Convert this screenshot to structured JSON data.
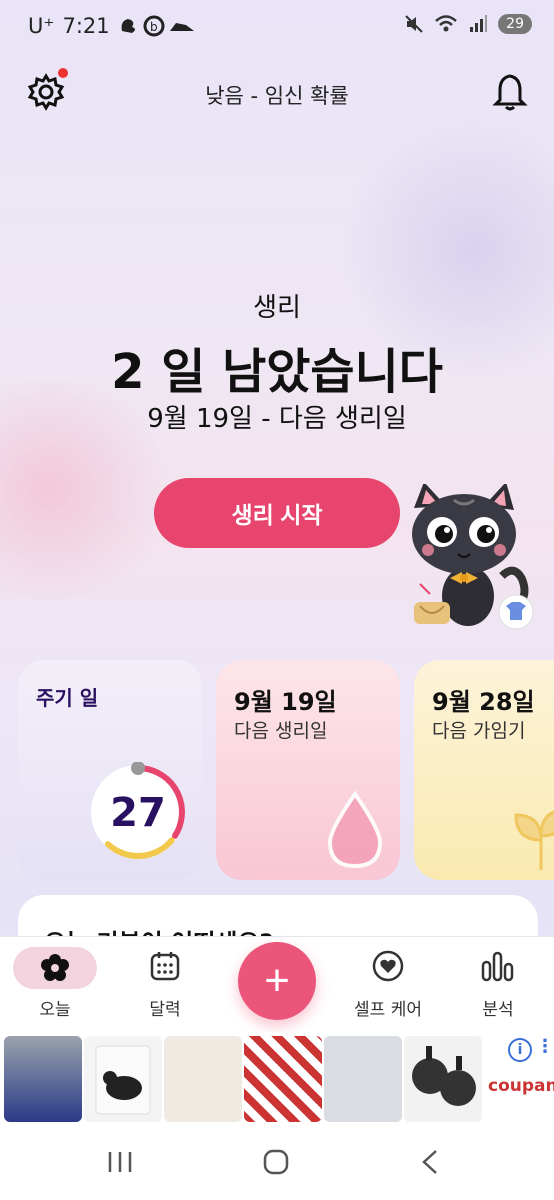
{
  "status_bar": {
    "carrier": "U⁺",
    "time": "7:21",
    "battery": "29"
  },
  "header": {
    "title": "낮음 - 임신 확률"
  },
  "hero": {
    "label": "생리",
    "main": "2 일 남았습니다",
    "sub": "9월 19일 - 다음 생리일",
    "button": "생리 시작"
  },
  "cards": [
    {
      "title": "주기 일",
      "value": "27",
      "progress": 0.62
    },
    {
      "title": "9월 19일",
      "subtitle": "다음 생리일"
    },
    {
      "title": "9월 28일",
      "subtitle": "다음 가임기"
    }
  ],
  "mood_card": {
    "text": "오늘 기분이 어떠세요?"
  },
  "nav": {
    "items": [
      {
        "label": "오늘",
        "icon": "flower-icon"
      },
      {
        "label": "달력",
        "icon": "calendar-icon"
      },
      {
        "label": "셀프 케어",
        "icon": "heart-icon"
      },
      {
        "label": "분석",
        "icon": "bar-chart-icon"
      }
    ],
    "fab": "+"
  },
  "ads": {
    "brand": "coupang",
    "info": "i"
  },
  "colors": {
    "accent": "#e8456e",
    "card_purple": "#2a1060"
  }
}
